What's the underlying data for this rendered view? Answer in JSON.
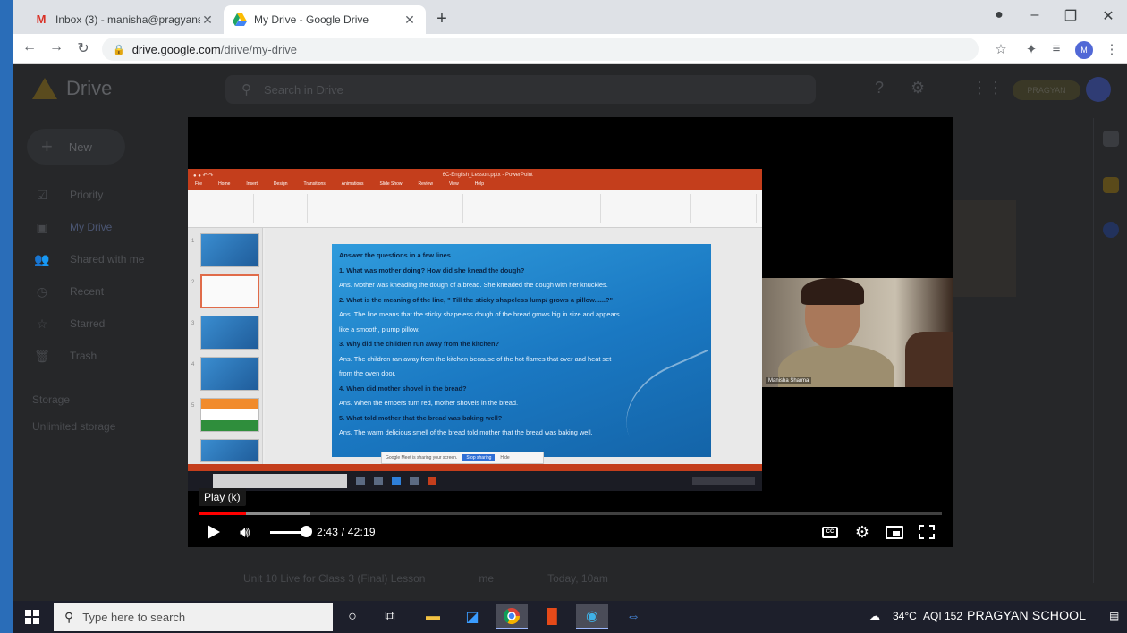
{
  "browser": {
    "tabs": [
      {
        "label": "Inbox (3) - manisha@pragyansc",
        "icon": "gmail-icon",
        "active": false
      },
      {
        "label": "My Drive - Google Drive",
        "icon": "drive-icon",
        "active": true
      }
    ],
    "new_tab": "+",
    "url_host": "drive.google.com",
    "url_path": "/drive/my-drive",
    "avatar_initials": "M"
  },
  "drive": {
    "app_name": "Drive",
    "search_placeholder": "Search in Drive",
    "new_label": "New",
    "nav": [
      {
        "label": "Priority",
        "icon": "priority-icon"
      },
      {
        "label": "My Drive",
        "icon": "my-drive-icon",
        "selected": true
      },
      {
        "label": "Shared with me",
        "icon": "shared-icon"
      },
      {
        "label": "Recent",
        "icon": "recent-icon"
      },
      {
        "label": "Starred",
        "icon": "star-icon"
      },
      {
        "label": "Trash",
        "icon": "trash-icon"
      }
    ],
    "storage_label": "Storage",
    "storage_used": "Unlimited storage",
    "account_label": "PRAGYAN",
    "file_row": {
      "name": "Unit 10 Live for Class 3 (Final) Lesson",
      "owner": "me",
      "modified": "Today, 10am"
    }
  },
  "ppt": {
    "file_name": "6C-English_Lesson.pptx - PowerPoint",
    "ribbon_tabs": [
      "File",
      "Home",
      "Insert",
      "Design",
      "Transitions",
      "Animations",
      "Slide Show",
      "Review",
      "View",
      "Help"
    ],
    "notification": "Google Meet is sharing your screen.",
    "notification_button": "Stop sharing",
    "notification_hide": "Hide",
    "slide_lines": [
      {
        "type": "q",
        "text": "Answer the questions in a few lines"
      },
      {
        "type": "q",
        "text": "1. What was mother doing? How did she knead the dough?"
      },
      {
        "type": "a",
        "text": "Ans. Mother was kneading the dough of a bread. She kneaded the dough with her knuckles."
      },
      {
        "type": "q",
        "text": "2. What is the meaning of the line, \" Till the sticky shapeless lump/ grows a pillow......?\""
      },
      {
        "type": "a",
        "text": "Ans. The line means that the sticky shapeless dough of the bread grows big in size and appears"
      },
      {
        "type": "a",
        "text": "like a smooth, plump pillow."
      },
      {
        "type": "q",
        "text": "3. Why did the children run away from the kitchen?"
      },
      {
        "type": "a",
        "text": "Ans. The children ran away from the kitchen because of the hot flames that over and heat set"
      },
      {
        "type": "a",
        "text": "from the oven door."
      },
      {
        "type": "q",
        "text": "4. When did mother shovel in the bread?"
      },
      {
        "type": "a",
        "text": "Ans. When the embers turn red, mother shovels in the bread."
      },
      {
        "type": "q",
        "text": "5. What told mother that the bread was baking well?"
      },
      {
        "type": "a",
        "text": "Ans. The warm delicious smell of the bread told mother that the bread was baking well."
      }
    ]
  },
  "cam": {
    "participant": "Manisha Sharma"
  },
  "player": {
    "tooltip": "Play (k)",
    "current_time": "2:43",
    "duration": "42:19",
    "time_display": "2:43 / 42:19",
    "played_fraction": 0.064,
    "buffered_fraction": 0.15,
    "volume_fraction": 0.75,
    "cc_label": "CC"
  },
  "taskbar": {
    "search_placeholder": "Type here to search",
    "apps": [
      "task-view-icon",
      "file-explorer-icon",
      "sticky-notes-icon",
      "chrome-icon",
      "office-icon",
      "edge-icon",
      "teamviewer-icon"
    ],
    "weather": "34°C",
    "aqi": "AQI 152",
    "school": "PRAGYAN SCHOOL"
  }
}
